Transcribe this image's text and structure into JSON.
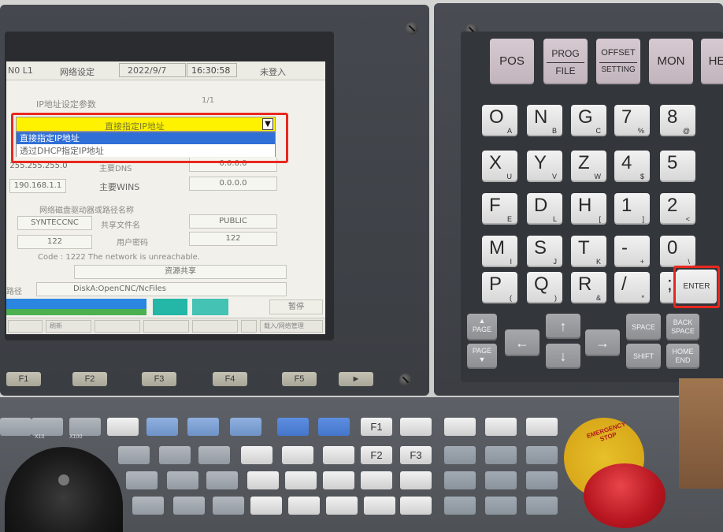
{
  "screen": {
    "status_bar": {
      "left_label": "N0 L1",
      "page_title": "网络设定",
      "date": "2022/9/7",
      "time": "16:30:58",
      "login_state": "未登入"
    },
    "section_title": "IP地址设定参数",
    "page_indicator": "1/1",
    "ip_mode_dropdown": {
      "selected_value": "直接指定IP地址",
      "arrow_icon": "chevron-down-icon",
      "options": [
        "直接指定IP地址",
        "透过DHCP指定IP地址"
      ]
    },
    "fields": {
      "subnet_value": "255.255.255.0",
      "dns_label": "主要DNS",
      "dns_value": "0.0.0.0",
      "gateway_value": "190.168.1.1",
      "wins_label": "主要WINS",
      "wins_value": "0.0.0.0",
      "network_drive_title": "网络磁盘驱动器或路径名称",
      "drive_name_value": "SYNTECCNC",
      "share_label": "共享文件名",
      "share_value": "PUBLIC",
      "user_value": "122",
      "password_label": "用户密码",
      "password_value": "122"
    },
    "message": "Code : 1222 The network is unreachable.",
    "resource_share_label": "资源共享",
    "path_label": "路径",
    "path_value": "DiskA:OpenCNC/NcFiles",
    "pause_label": "暂停",
    "bottom_softkeys": [
      "",
      "刷新",
      "",
      "",
      "",
      "",
      "载入/网络管理"
    ],
    "bar_colors": {
      "blue": "#2a86e0",
      "green": "#4caf50",
      "teal": "#24b6a6"
    }
  },
  "function_keys": [
    "F1",
    "F2",
    "F3",
    "F4",
    "F5",
    "►"
  ],
  "keypad": {
    "function_row": [
      {
        "top": "POS",
        "bottom": ""
      },
      {
        "top": "PROG",
        "bottom": "FILE"
      },
      {
        "top": "OFFSET",
        "bottom": "SETTING"
      },
      {
        "top": "MON",
        "bottom": ""
      },
      {
        "top": "HE",
        "bottom": ""
      }
    ],
    "rows": [
      [
        {
          "m": "O",
          "s": "A"
        },
        {
          "m": "N",
          "s": "B"
        },
        {
          "m": "G",
          "s": "C"
        },
        {
          "m": "7",
          "s": "%"
        },
        {
          "m": "8",
          "s": "@"
        }
      ],
      [
        {
          "m": "X",
          "s": "U"
        },
        {
          "m": "Y",
          "s": "V"
        },
        {
          "m": "Z",
          "s": "W"
        },
        {
          "m": "4",
          "s": "$"
        },
        {
          "m": "5",
          "s": ""
        }
      ],
      [
        {
          "m": "F",
          "s": "E"
        },
        {
          "m": "D",
          "s": "L"
        },
        {
          "m": "H",
          "s": "["
        },
        {
          "m": "1",
          "s": "]"
        },
        {
          "m": "2",
          "s": "<"
        }
      ],
      [
        {
          "m": "M",
          "s": "I"
        },
        {
          "m": "S",
          "s": "J"
        },
        {
          "m": "T",
          "s": "K"
        },
        {
          "m": "-",
          "s": "+"
        },
        {
          "m": "0",
          "s": "\\"
        }
      ],
      [
        {
          "m": "P",
          "s": "("
        },
        {
          "m": "Q",
          "s": ")"
        },
        {
          "m": "R",
          "s": "&"
        },
        {
          "m": "/",
          "s": "*"
        },
        {
          "m": ";",
          "s": "_"
        }
      ]
    ],
    "enter_label": "ENTER",
    "page_up_label": "PAGE",
    "page_down_label": "PAGE",
    "space_label": "SPACE",
    "back_label": "BACK SPACE",
    "shift_label": "SHIFT",
    "home_label": "HOME END"
  },
  "operator_panel": {
    "f_keys": [
      "F1",
      "F2",
      "F3"
    ],
    "jog_label_1": "X10",
    "jog_label_2": "X100",
    "emergency_label": "EMERGENCY STOP"
  },
  "highlight_color": "#e8281f"
}
